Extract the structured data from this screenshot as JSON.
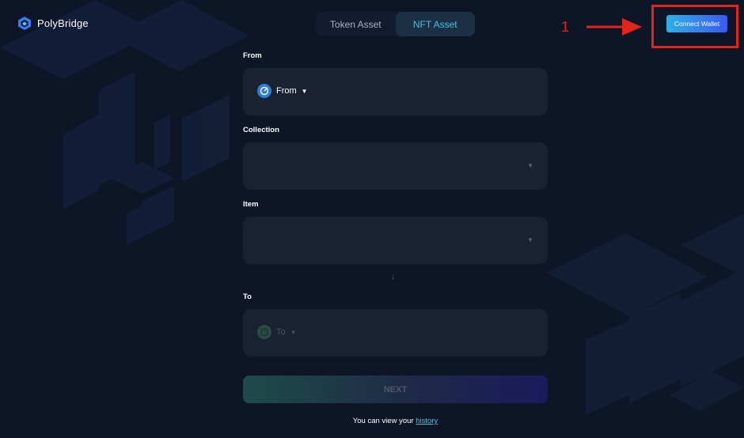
{
  "app": {
    "name": "PolyBridge"
  },
  "tabs": [
    {
      "label": "Token Asset",
      "active": false
    },
    {
      "label": "NFT Asset",
      "active": true
    }
  ],
  "annotation": {
    "step_number": "1",
    "color": "#e3241a"
  },
  "header": {
    "connect_wallet_label": "Connect Wallet"
  },
  "form": {
    "from_label": "From",
    "from_chain": "From",
    "collection_label": "Collection",
    "item_label": "Item",
    "to_label": "To",
    "to_chain": "To",
    "next_label": "NEXT"
  },
  "footer": {
    "history_prefix": "You can view your",
    "history_link": "history"
  },
  "colors": {
    "accent": "#44c1e0",
    "background": "#0d1526",
    "field": "#1a2232"
  }
}
